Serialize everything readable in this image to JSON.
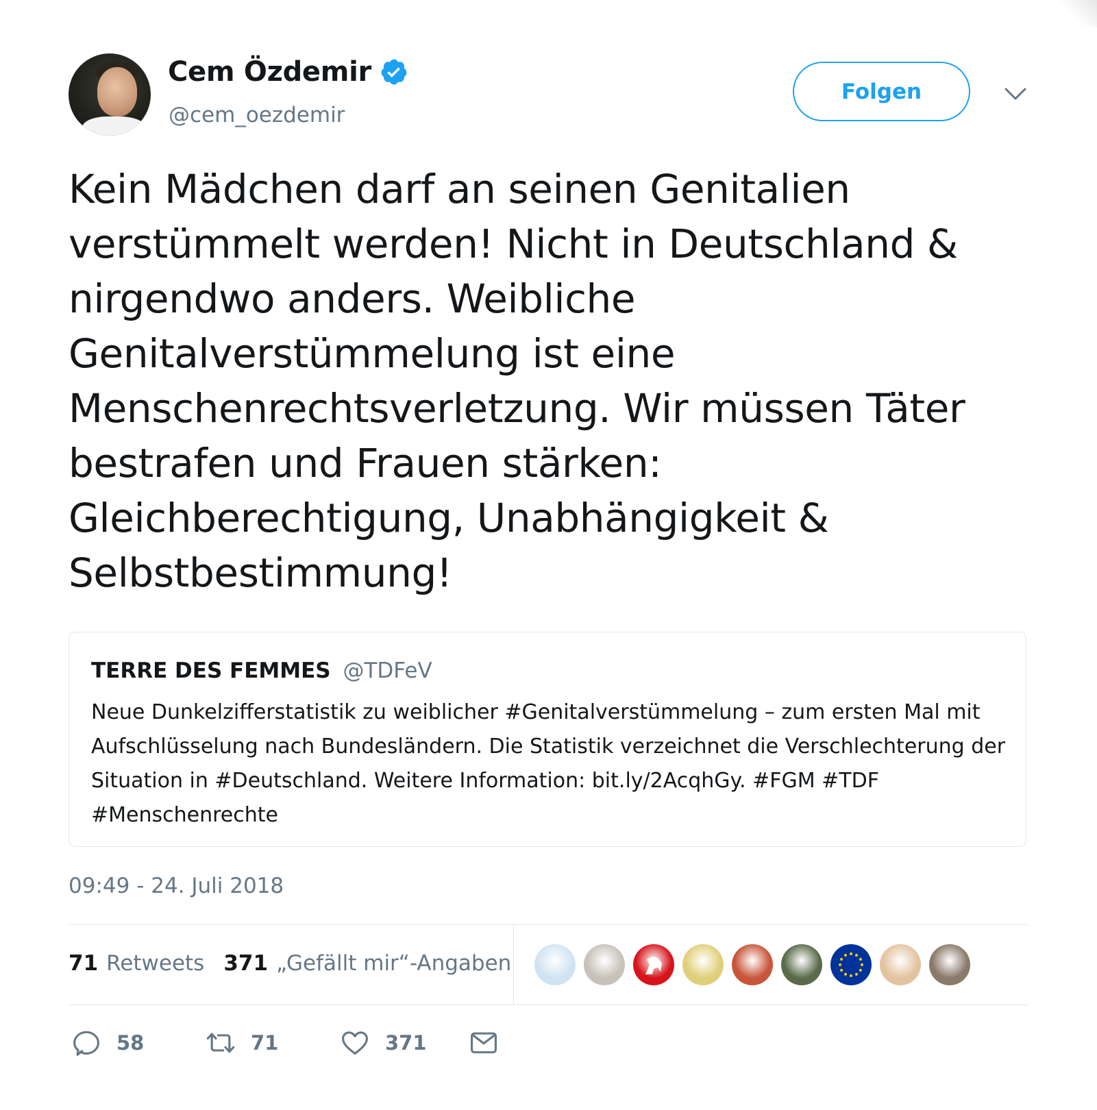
{
  "author": {
    "name": "Cem Özdemir",
    "handle": "@cem_oezdemir",
    "verified": true,
    "avatar_icon": "person-avatar"
  },
  "follow_label": "Folgen",
  "tweet_text": "Kein Mädchen darf an seinen Genitalien verstümmelt werden! Nicht in Deutschland & nirgendwo anders. Weibliche Genitalverstümmelung ist eine Menschenrechtsverletzung. Wir müssen Täter bestrafen und Frauen stärken: Gleichberechtigung, Unabhängigkeit & Selbstbestimmung!",
  "quoted": {
    "name": "TERRE DES FEMMES",
    "handle": "@TDFeV",
    "text": "Neue Dunkelzifferstatistik zu weiblicher #Genitalverstümmelung – zum ersten Mal mit Aufschlüsselung nach Bundesländern. Die Statistik verzeichnet die Verschlechterung der Situation in #Deutschland. Weitere Information: bit.ly/2AcqhGy. #FGM #TDF #Menschenrechte"
  },
  "timestamp": "09:49 - 24. Juli 2018",
  "stats": {
    "retweets_count": "71",
    "retweets_label": "Retweets",
    "likes_count": "371",
    "likes_label": "„Gefällt mir“-Angaben"
  },
  "likers": [
    {
      "name": "liker-1",
      "color": "#cfe3f2"
    },
    {
      "name": "liker-2",
      "color": "#c7c2b8"
    },
    {
      "name": "liker-3",
      "color": "#d7141a"
    },
    {
      "name": "liker-4",
      "color": "#e0cf7a"
    },
    {
      "name": "liker-5",
      "color": "#c8553a"
    },
    {
      "name": "liker-6",
      "color": "#5a6b4a"
    },
    {
      "name": "liker-7",
      "color": "#003399"
    },
    {
      "name": "liker-8",
      "color": "#e2c39f"
    },
    {
      "name": "liker-9",
      "color": "#8a7a6a"
    }
  ],
  "actions": {
    "reply_count": "58",
    "retweet_count": "71",
    "like_count": "371"
  },
  "colors": {
    "accent": "#1da1f2",
    "text": "#14171a",
    "secondary": "#657786",
    "border": "#e1e8ed"
  }
}
